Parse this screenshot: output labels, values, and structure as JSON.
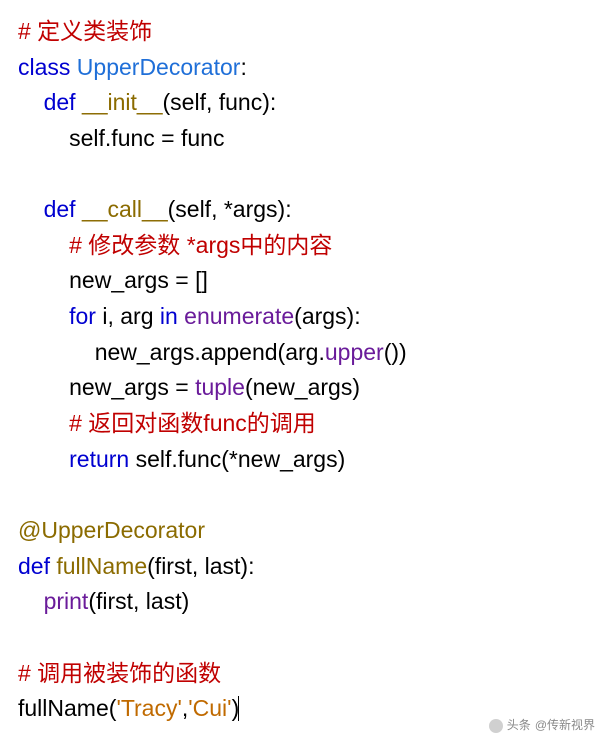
{
  "code": {
    "line1": {
      "comment": "# 定义类装饰"
    },
    "line2": {
      "kw_class": "class",
      "name": "UpperDecorator",
      "colon": ":"
    },
    "line3": {
      "kw_def": "def",
      "fname": "__init__",
      "params": "(self, func):"
    },
    "line4": {
      "body": "self.func = func"
    },
    "line5": {
      "blank": ""
    },
    "line6": {
      "kw_def": "def",
      "fname": "__call__",
      "params": "(self, *args):"
    },
    "line7": {
      "comment": "# 修改参数 *args中的内容"
    },
    "line8": {
      "body": "new_args = []"
    },
    "line9": {
      "kw_for": "for",
      "mid": " i, arg ",
      "kw_in": "in",
      "builtin": " enumerate",
      "tail": "(args):"
    },
    "line10": {
      "pre": "new_args.append(arg.",
      "builtin": "upper",
      "tail": "())"
    },
    "line11": {
      "pre": "new_args = ",
      "builtin": "tuple",
      "tail": "(new_args)"
    },
    "line12": {
      "comment": "# 返回对函数func的调用"
    },
    "line13": {
      "kw_return": "return",
      "body": " self.func(*new_args)"
    },
    "line14": {
      "blank": ""
    },
    "line15": {
      "decorator": "@UpperDecorator"
    },
    "line16": {
      "kw_def": "def",
      "fname": "fullName",
      "params": "(first, last):"
    },
    "line17": {
      "builtin": "print",
      "tail": "(first, last)"
    },
    "line18": {
      "blank": ""
    },
    "line19": {
      "comment": "# 调用被装饰的函数"
    },
    "line20": {
      "fn": "fullName",
      "open": "(",
      "s1": "'Tracy'",
      "comma": ",",
      "s2": "'Cui'",
      "close": ")"
    }
  },
  "watermark": {
    "label": "头条",
    "author": "@传新视界"
  }
}
